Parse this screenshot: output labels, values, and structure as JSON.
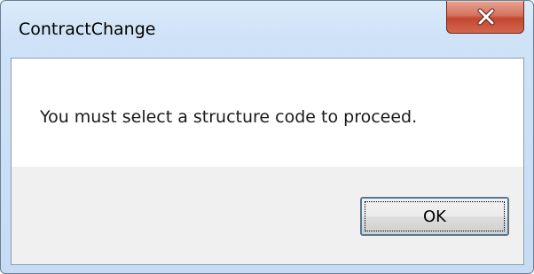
{
  "window": {
    "title": "ContractChange",
    "close_icon": "close-icon"
  },
  "dialog": {
    "message": "You must select a structure code to proceed.",
    "ok_label": "OK"
  },
  "colors": {
    "close_button_red": "#c4472f",
    "titlebar_blue": "#cfe2f7",
    "focus_blue": "#3c7fb1"
  }
}
